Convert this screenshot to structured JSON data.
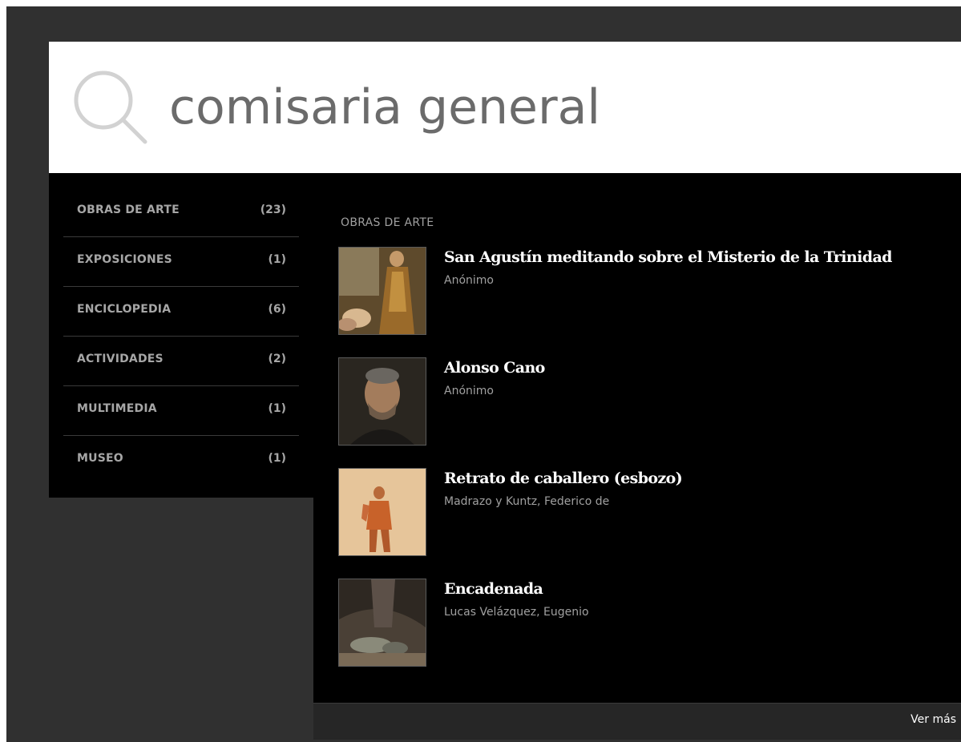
{
  "search": {
    "query": "comisaria general"
  },
  "sidebar": {
    "items": [
      {
        "label": "OBRAS DE ARTE",
        "count": "(23)"
      },
      {
        "label": "EXPOSICIONES",
        "count": "(1)"
      },
      {
        "label": "ENCICLOPEDIA",
        "count": "(6)"
      },
      {
        "label": "ACTIVIDADES",
        "count": "(2)"
      },
      {
        "label": "MULTIMEDIA",
        "count": "(1)"
      },
      {
        "label": "MUSEO",
        "count": "(1)"
      }
    ]
  },
  "results": {
    "heading": "OBRAS DE ARTE",
    "items": [
      {
        "title": "San Agustín meditando sobre el Misterio de la Trinidad",
        "author": "Anónimo"
      },
      {
        "title": "Alonso Cano",
        "author": "Anónimo"
      },
      {
        "title": "Retrato de caballero (esbozo)",
        "author": "Madrazo y Kuntz, Federico de"
      },
      {
        "title": "Encadenada",
        "author": "Lucas Velázquez, Eugenio"
      }
    ],
    "more_label": "Ver más"
  },
  "colors": {
    "page_background": "#303030",
    "panel_background": "#000000",
    "search_background": "#ffffff",
    "query_text": "#6b6b6b",
    "muted_text": "#a6a6a6",
    "title_text": "#ffffff"
  },
  "icons": {
    "search": "search-icon (magnifying glass)"
  }
}
